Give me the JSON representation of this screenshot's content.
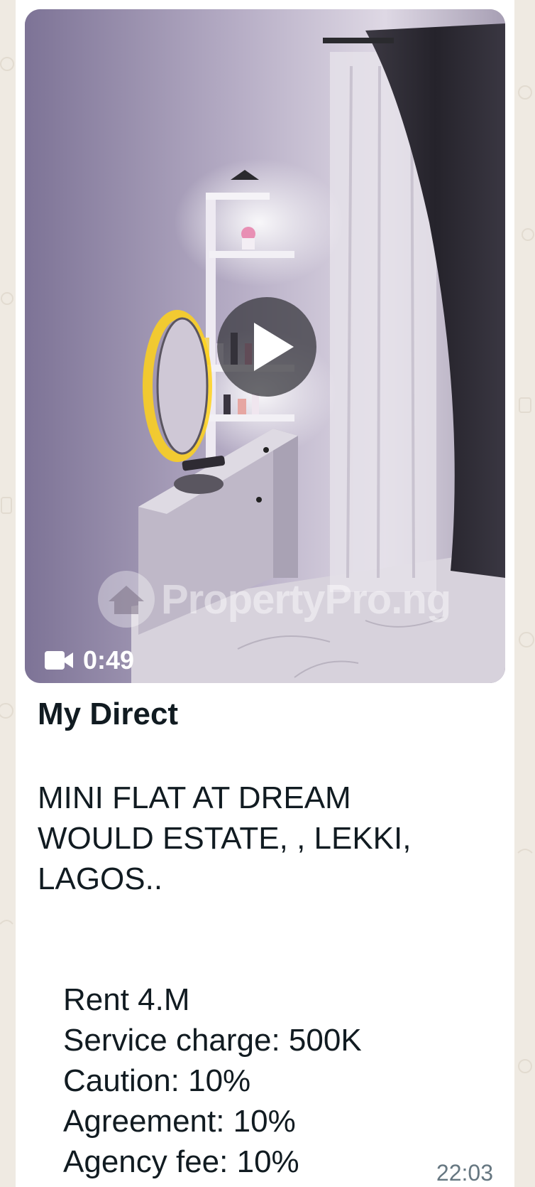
{
  "video": {
    "duration": "0:49",
    "watermark": "PropertyPro.ng",
    "icons": {
      "camera": "video-camera-icon",
      "play": "play-icon",
      "logo": "house-logo-icon"
    }
  },
  "message": {
    "sender": "My Direct",
    "title_lines": [
      "MINI FLAT AT DREAM",
      "WOULD ESTATE, , LEKKI,",
      "LAGOS.."
    ],
    "details": [
      "Rent 4.M",
      "Service charge: 500K",
      "Caution:  10%",
      "Agreement:  10%",
      "Agency fee: 10%"
    ],
    "time": "22:03"
  },
  "colors": {
    "chat_background": "#efeae2",
    "bubble": "#ffffff",
    "text": "#111b21",
    "meta": "#667781"
  }
}
